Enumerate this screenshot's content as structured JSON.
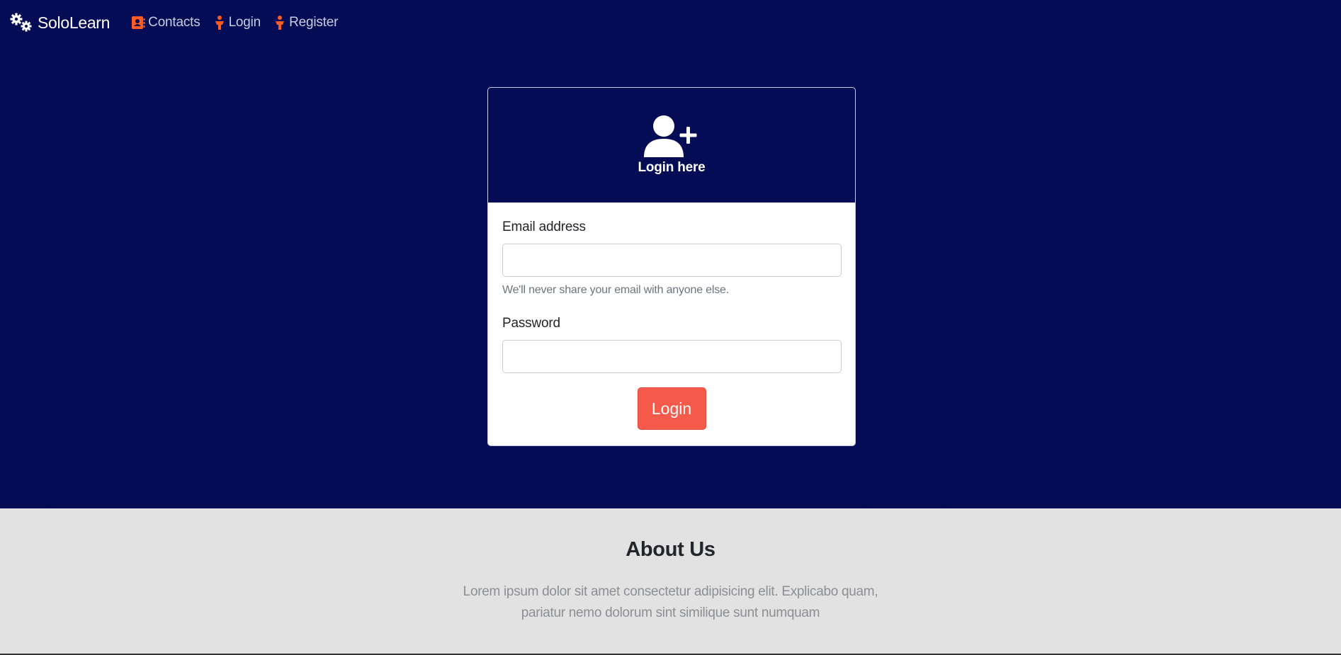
{
  "navbar": {
    "brand": "SoloLearn",
    "brand_icon": "gears-icon",
    "items": [
      {
        "label": "Contacts",
        "icon": "address-card-icon"
      },
      {
        "label": "Login",
        "icon": "person-icon"
      },
      {
        "label": "Register",
        "icon": "person-icon"
      }
    ]
  },
  "login_card": {
    "header_icon": "user-plus-icon",
    "title": "Login here",
    "email_label": "Email address",
    "email_value": "",
    "email_help": "We'll never share your email with anyone else.",
    "password_label": "Password",
    "password_value": "",
    "submit_label": "Login"
  },
  "about": {
    "title": "About Us",
    "text": "Lorem ipsum dolor sit amet consectetur adipisicing elit. Explicabo quam, pariatur nemo dolorum sint similique sunt numquam"
  },
  "colors": {
    "hero_background": "#030c54",
    "accent_orange": "#ff5a1f",
    "button": "#f55a4a",
    "section_background": "#e2e2e2"
  }
}
